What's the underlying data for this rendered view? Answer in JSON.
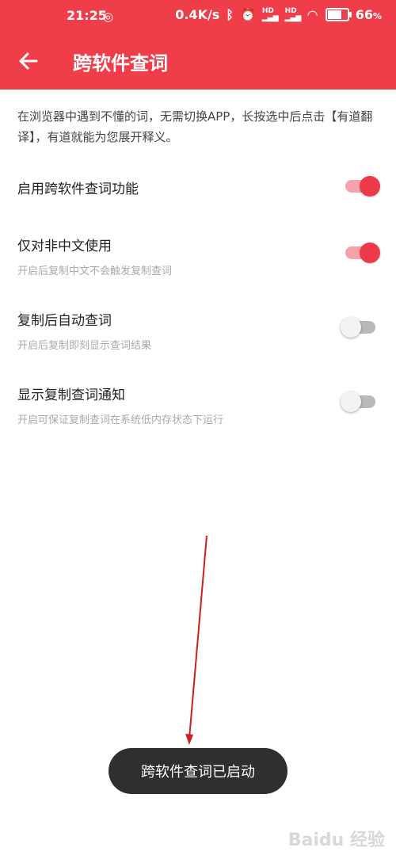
{
  "status_bar": {
    "time": "21:25",
    "network_speed": "0.4K/s",
    "hd1": "HD",
    "hd2": "HD",
    "battery": "66",
    "battery_unit": "%",
    "battery_level": 0.66
  },
  "header": {
    "title": "跨软件查词",
    "background": "#ef3d4a"
  },
  "description": "在浏览器中遇到不懂的词，无需切换APP，长按选中后点击【有道翻译】，有道就能为您展开释义。",
  "settings": [
    {
      "title": "启用跨软件查词功能",
      "subtitle": "",
      "enabled": true
    },
    {
      "title": "仅对非中文使用",
      "subtitle": "开启后复制中文不会触发复制查词",
      "enabled": true
    },
    {
      "title": "复制后自动查词",
      "subtitle": "开启后复制即刻显示查词结果",
      "enabled": false
    },
    {
      "title": "显示复制查词通知",
      "subtitle": "开启可保证复制查词在系统低内存状态下运行",
      "enabled": false
    }
  ],
  "toast": {
    "text": "跨软件查词已启动"
  },
  "watermark": "Baidu 经验",
  "colors": {
    "accent": "#ee3949",
    "toggle_on_track": "#f4a3aa",
    "toggle_off_track": "#b9b9b9"
  }
}
